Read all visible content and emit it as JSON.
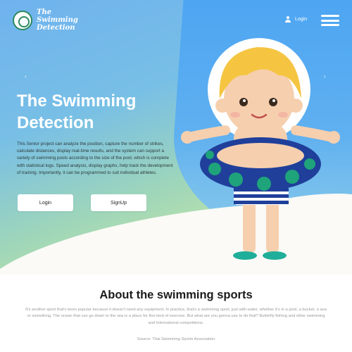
{
  "brand": {
    "line1": "The",
    "line2": "Swimming",
    "line3": "Detection"
  },
  "header": {
    "login_label": "Login"
  },
  "hero": {
    "arrow_left": "‹",
    "arrow_right": "›",
    "title_line1": "The Swimming",
    "title_line2": "Detection",
    "description": "This Senior project can analyze the position, capture the number of strikes, calculate distances, display real-time results, and the system can support a variety of swimming pools according to the size of the pool, which is complete with statistical logs. Speed analysis, display graphs, help track the development of training. Importantly, it can be programmed to suit individual athletes.",
    "login_button": "Login",
    "signup_button": "SignUp"
  },
  "about": {
    "title": "About the swimming sports",
    "text": "It's another sport that's been popular because it doesn't need any equipment. In practice, that's a swimming sport, just with water, whether it's in a pool, a bucket, a sea or something. The ocean that can go down to the sea is a place for this kind of exercise. But what are you gonna use to do that? Butterfly fishing and other swimming and International competitions.",
    "source": "Source: Thai Swimming Sports Association"
  },
  "colors": {
    "sky": "#5fb0f0",
    "grass": "#c8e8a2",
    "ring": "#1f3f9a",
    "ring_dots": "#1fa37a"
  },
  "icons": [
    "logo-icon",
    "user-icon",
    "hamburger-menu-icon",
    "chevron-left-icon",
    "chevron-right-icon"
  ]
}
